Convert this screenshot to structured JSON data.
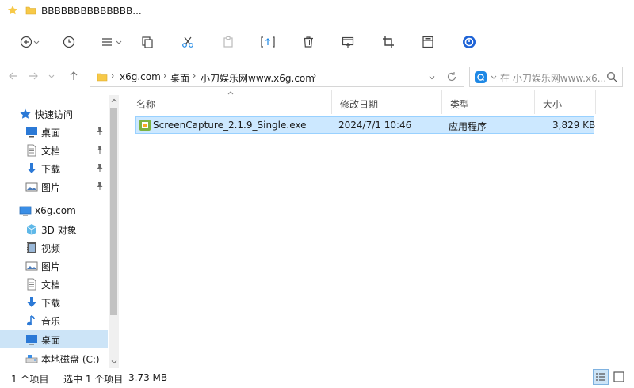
{
  "window": {
    "title": "BBBBBBBBBBBBBB..."
  },
  "address": {
    "crumbs": [
      "x6g.com",
      "桌面",
      "小刀娱乐网www.x6g.com"
    ]
  },
  "search": {
    "placeholder": "在 小刀娱乐网www.x6..."
  },
  "nav": {
    "quick_access": "快速访问",
    "pinned": [
      {
        "label": "桌面",
        "icon": "desktop-icon"
      },
      {
        "label": "文档",
        "icon": "document-icon"
      },
      {
        "label": "下载",
        "icon": "download-icon"
      },
      {
        "label": "图片",
        "icon": "picture-icon"
      }
    ],
    "computer": "x6g.com",
    "computer_items": [
      {
        "label": "3D 对象",
        "icon": "cube-icon"
      },
      {
        "label": "视频",
        "icon": "video-icon"
      },
      {
        "label": "图片",
        "icon": "picture-icon"
      },
      {
        "label": "文档",
        "icon": "document-icon"
      },
      {
        "label": "下载",
        "icon": "download-icon"
      },
      {
        "label": "音乐",
        "icon": "music-icon"
      },
      {
        "label": "桌面",
        "icon": "desktop-icon",
        "selected": true
      },
      {
        "label": "本地磁盘 (C:)",
        "icon": "drive-icon"
      }
    ]
  },
  "columns": {
    "name": "名称",
    "modified": "修改日期",
    "type": "类型",
    "size": "大小"
  },
  "files": [
    {
      "name": "ScreenCapture_2.1.9_Single.exe",
      "modified": "2024/7/1 10:46",
      "type": "应用程序",
      "size": "3,829 KB"
    }
  ],
  "status": {
    "count": "1 个项目",
    "selected": "选中 1 个项目",
    "selected_size": "3.73 MB"
  },
  "colors": {
    "accent": "#1e88e5",
    "selection": "#cce8ff",
    "folder": "#f7c948"
  }
}
